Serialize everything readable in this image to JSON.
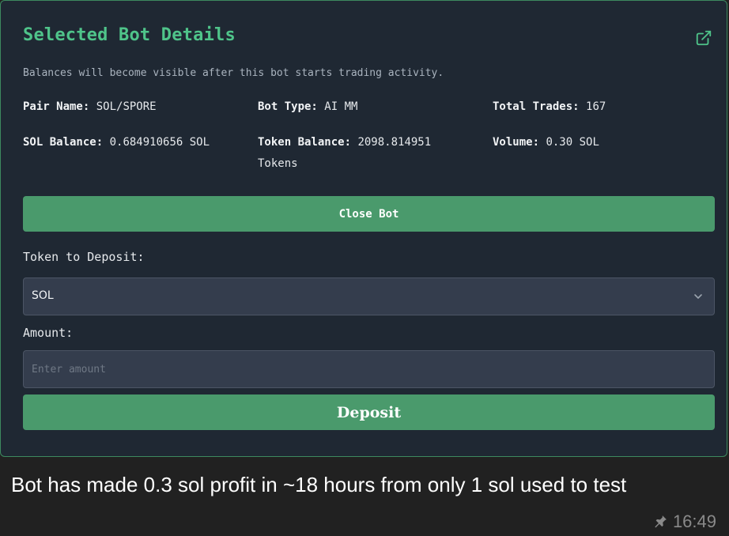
{
  "panel": {
    "title": "Selected Bot Details",
    "note": "Balances will become visible after this bot starts trading activity.",
    "stats": {
      "pair_name": {
        "label": "Pair Name:",
        "value": "SOL/SPORE"
      },
      "bot_type": {
        "label": "Bot Type:",
        "value": "AI MM"
      },
      "total_trades": {
        "label": "Total Trades:",
        "value": "167"
      },
      "sol_balance": {
        "label": "SOL Balance:",
        "value": "0.684910656 SOL"
      },
      "token_balance": {
        "label": "Token Balance:",
        "value": "2098.814951",
        "value_line2": "Tokens"
      },
      "volume": {
        "label": "Volume:",
        "value": "0.30 SOL"
      }
    },
    "close_button": "Close Bot",
    "deposit_form": {
      "token_label": "Token to Deposit:",
      "token_selected": "SOL",
      "amount_label": "Amount:",
      "amount_value": "",
      "amount_placeholder": "Enter amount",
      "deposit_button": "Deposit"
    }
  },
  "message": {
    "text": "Bot has made 0.3 sol profit in ~18 hours from only 1 sol used to test",
    "time": "16:49"
  },
  "icons": {
    "external_link": "external-link-icon",
    "select_chevron": "chevron-down-icon",
    "pinned": "pin-icon"
  },
  "colors": {
    "accent_green": "#4fc48a",
    "button_green": "#4a9a6c",
    "panel_bg": "#1f2833",
    "chat_bg": "#212121"
  }
}
